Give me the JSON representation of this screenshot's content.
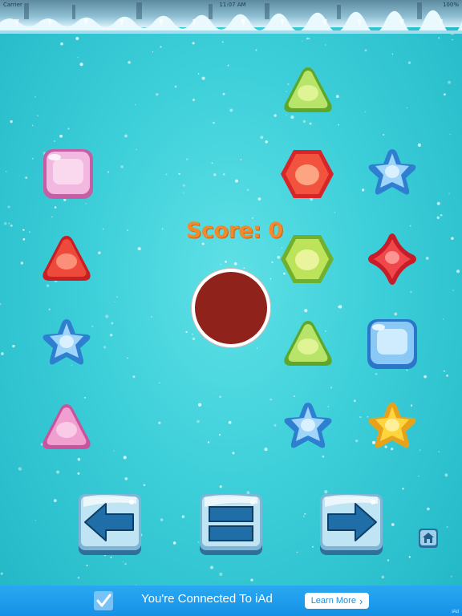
{
  "status_bar": {
    "carrier": "Carrier",
    "time": "11:07 AM",
    "battery": "100%"
  },
  "score": {
    "label": "Score:",
    "value": "0"
  },
  "pieces": [
    {
      "name": "triangle-green-top",
      "shape": "triangle",
      "color": "green"
    },
    {
      "name": "square-pink",
      "shape": "square",
      "color": "pink"
    },
    {
      "name": "hexagon-red",
      "shape": "hexagon",
      "color": "red"
    },
    {
      "name": "star-blue-right",
      "shape": "star",
      "color": "blue"
    },
    {
      "name": "triangle-red",
      "shape": "triangle",
      "color": "red"
    },
    {
      "name": "hexagon-green",
      "shape": "hexagon",
      "color": "green"
    },
    {
      "name": "diamond-red",
      "shape": "diamond",
      "color": "red"
    },
    {
      "name": "star-blue-left",
      "shape": "star",
      "color": "blue"
    },
    {
      "name": "triangle-green-mid",
      "shape": "triangle",
      "color": "green"
    },
    {
      "name": "square-blue",
      "shape": "square",
      "color": "blue"
    },
    {
      "name": "triangle-pink",
      "shape": "triangle",
      "color": "pink"
    },
    {
      "name": "star-blue-bottom",
      "shape": "star",
      "color": "blue"
    },
    {
      "name": "star-yellow",
      "shape": "star",
      "color": "yellow"
    }
  ],
  "controls": {
    "left": {
      "icon": "arrow-left-icon"
    },
    "pause": {
      "icon": "pause-icon"
    },
    "right": {
      "icon": "arrow-right-icon"
    },
    "home": {
      "icon": "home-icon"
    }
  },
  "ad": {
    "text": "You're Connected To iAd",
    "button_label": "Learn More",
    "button_chevron": "›",
    "corner": "iAd"
  },
  "colors": {
    "background": "#3ccfd9",
    "score_text": "#f08a2c",
    "ball": "#8f231b",
    "ad_bar": "#1f9ded"
  }
}
